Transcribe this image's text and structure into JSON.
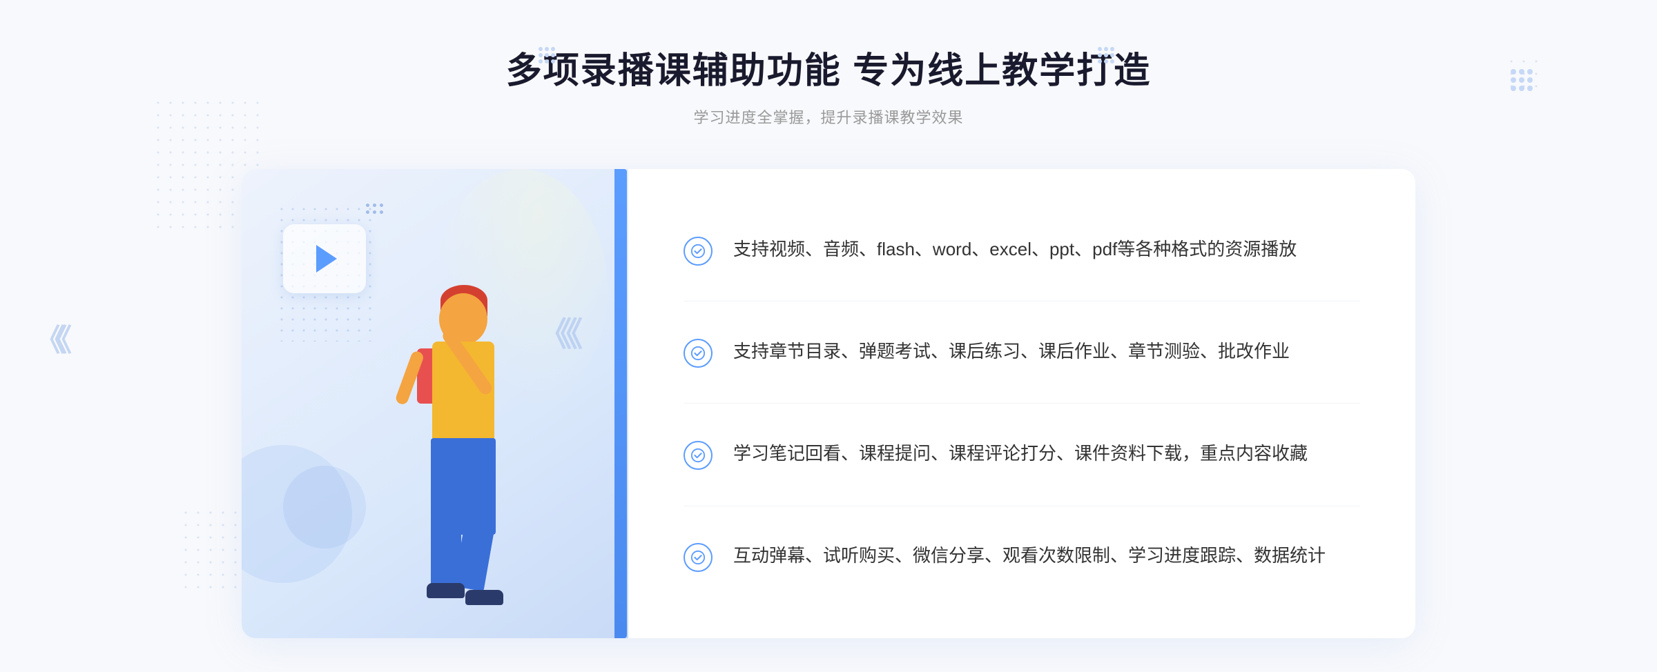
{
  "page": {
    "background": "#f8f9fc"
  },
  "header": {
    "main_title": "多项录播课辅助功能 专为线上教学打造",
    "sub_title": "学习进度全掌握，提升录播课教学效果"
  },
  "features": [
    {
      "id": 1,
      "text": "支持视频、音频、flash、word、excel、ppt、pdf等各种格式的资源播放"
    },
    {
      "id": 2,
      "text": "支持章节目录、弹题考试、课后练习、课后作业、章节测验、批改作业"
    },
    {
      "id": 3,
      "text": "学习笔记回看、课程提问、课程评论打分、课件资料下载，重点内容收藏"
    },
    {
      "id": 4,
      "text": "互动弹幕、试听购买、微信分享、观看次数限制、学习进度跟踪、数据统计"
    }
  ],
  "icons": {
    "check_circle": "check-circle-icon",
    "play": "play-icon",
    "chevron_left": "《",
    "dots_decoration": "dots-decoration-icon"
  },
  "colors": {
    "accent_blue": "#5b9cff",
    "text_dark": "#1a1a2e",
    "text_gray": "#666666",
    "text_light": "#999999",
    "bg_light": "#f8f9fc",
    "card_bg": "#ffffff",
    "left_panel_bg": "#dae8fb"
  }
}
